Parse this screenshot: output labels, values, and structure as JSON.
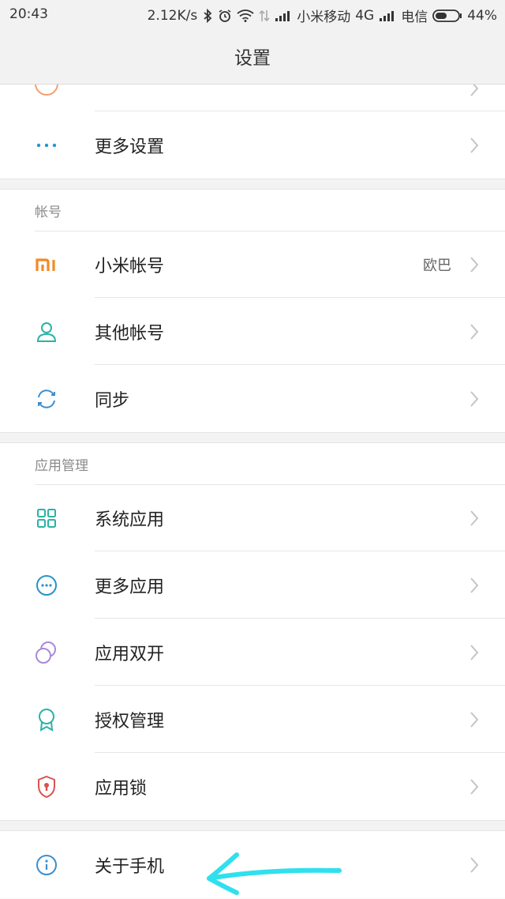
{
  "status": {
    "time": "20:43",
    "speed": "2.12K/s",
    "carrier1": "小米移动",
    "network1": "4G",
    "carrier2": "电信",
    "battery": "44%"
  },
  "title": "设置",
  "sections": {
    "top": {
      "items": [
        {
          "label": "更多设置",
          "icon": "more-dots-icon"
        }
      ]
    },
    "accounts": {
      "header": "帐号",
      "items": [
        {
          "label": "小米帐号",
          "value": "欧巴",
          "icon": "mi-logo-icon"
        },
        {
          "label": "其他帐号",
          "icon": "person-icon"
        },
        {
          "label": "同步",
          "icon": "sync-icon"
        }
      ]
    },
    "apps": {
      "header": "应用管理",
      "items": [
        {
          "label": "系统应用",
          "icon": "grid-icon"
        },
        {
          "label": "更多应用",
          "icon": "more-circle-icon"
        },
        {
          "label": "应用双开",
          "icon": "dual-circle-icon"
        },
        {
          "label": "授权管理",
          "icon": "badge-icon"
        },
        {
          "label": "应用锁",
          "icon": "shield-lock-icon"
        }
      ]
    },
    "about": {
      "items": [
        {
          "label": "关于手机",
          "icon": "info-icon"
        }
      ]
    }
  },
  "colors": {
    "accent_teal": "#2ab3a6",
    "mi_orange": "#f28a24",
    "info_blue": "#3a8fd1",
    "purple": "#a98ad8",
    "red": "#d9534f",
    "annotation": "#2fe0ee"
  }
}
